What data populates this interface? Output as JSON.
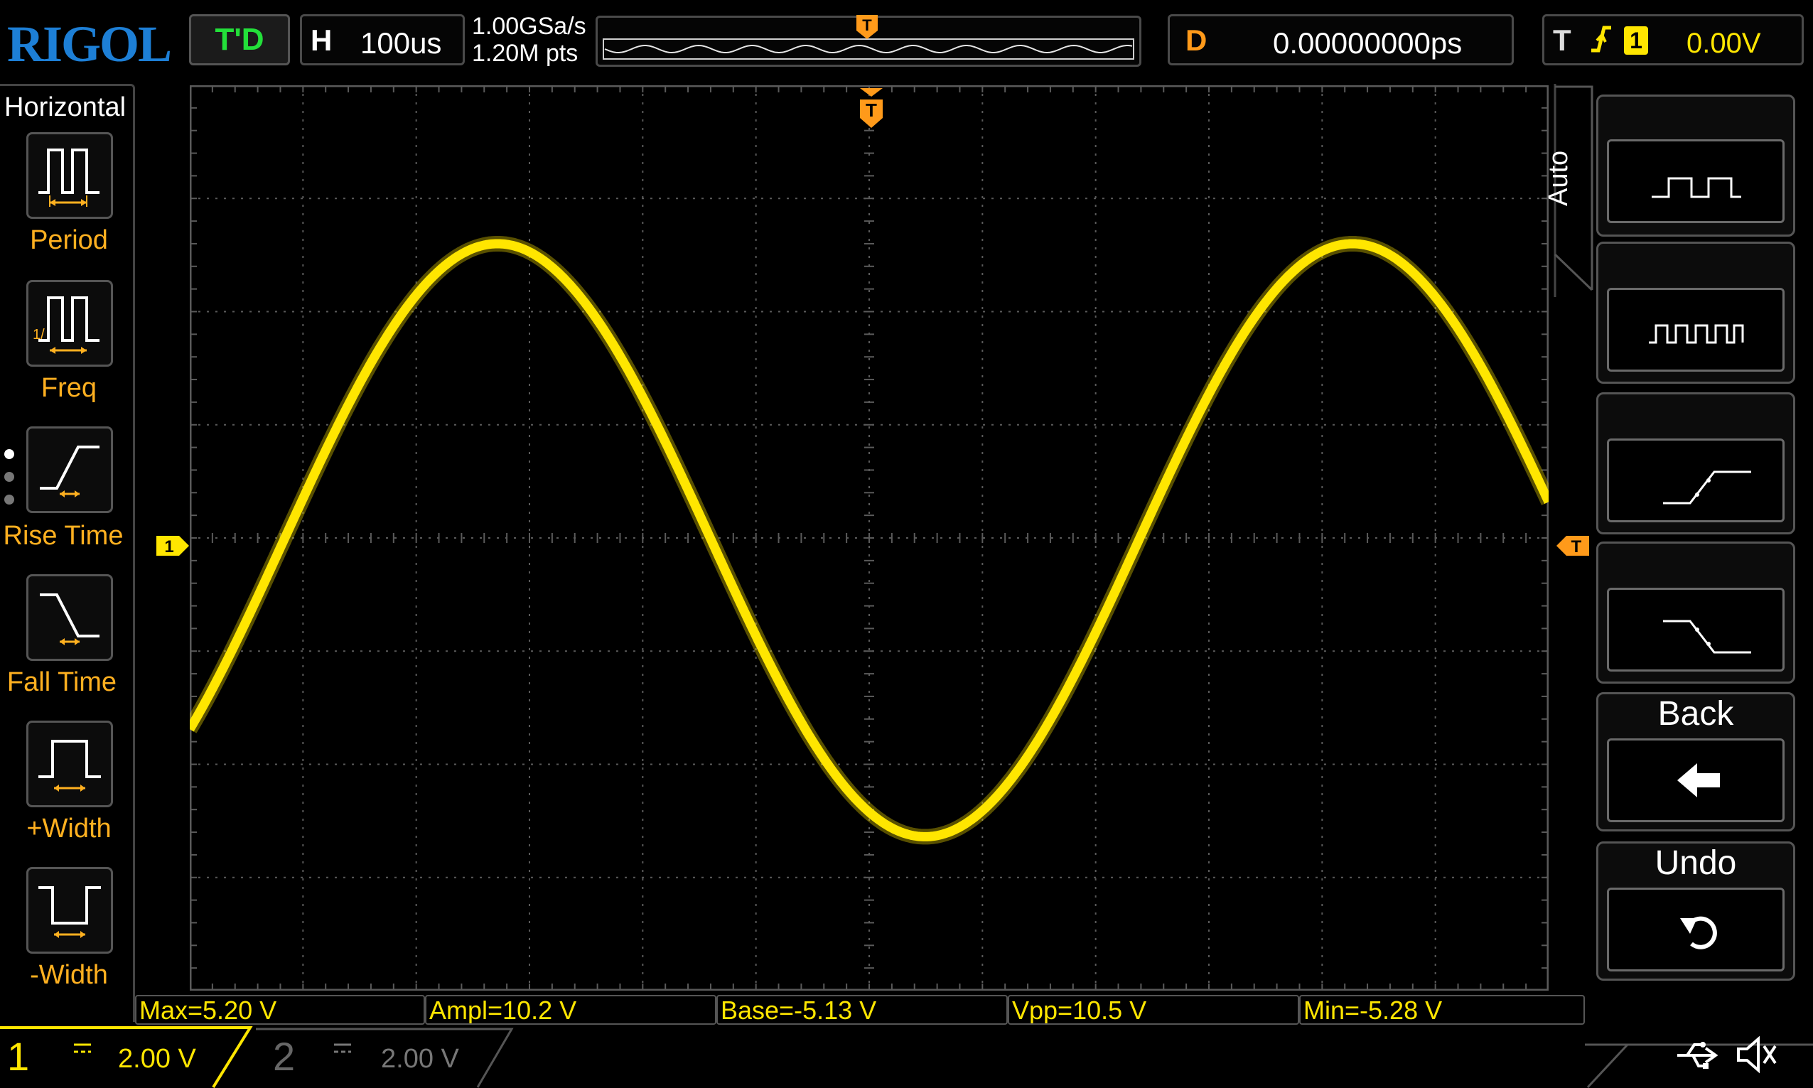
{
  "header": {
    "brand": "RIGOL",
    "run_status": "T'D",
    "horizontal_label": "H",
    "timebase": "100us",
    "sample_rate": "1.00GSa/s",
    "memory_depth": "1.20M pts",
    "delay_label": "D",
    "delay_value": "0.00000000ps",
    "trigger_label": "T",
    "trigger_slope_icon": "rising-edge-icon",
    "trigger_source": "1",
    "trigger_level": "0.00V"
  },
  "left_menu": {
    "title": "Horizontal",
    "items": [
      {
        "label": "Period",
        "icon": "period-icon"
      },
      {
        "label": "Freq",
        "icon": "frequency-icon"
      },
      {
        "label": "Rise Time",
        "icon": "rise-time-icon"
      },
      {
        "label": "Fall Time",
        "icon": "fall-time-icon"
      },
      {
        "label": "+Width",
        "icon": "positive-width-icon"
      },
      {
        "label": "-Width",
        "icon": "negative-width-icon"
      }
    ]
  },
  "right_menu": {
    "tab_label": "Auto",
    "back_label": "Back",
    "undo_label": "Undo"
  },
  "markers": {
    "trigger_position": "T",
    "trigger_level": "T",
    "channel1_offset": "1"
  },
  "measurements": [
    {
      "label": "Max=5.20 V"
    },
    {
      "label": "Ampl=10.2 V"
    },
    {
      "label": "Base=-5.13 V"
    },
    {
      "label": "Vpp=10.5 V"
    },
    {
      "label": "Min=-5.28 V"
    }
  ],
  "channels": [
    {
      "number": "1",
      "scale": "2.00 V",
      "active": true
    },
    {
      "number": "2",
      "scale": "2.00 V",
      "active": false
    }
  ],
  "waveform": {
    "channel": "1",
    "color": "#ffe600",
    "shape": "sine",
    "peak_volts": 5.2,
    "trough_volts": -5.28,
    "volts_per_div": 2.0,
    "time_per_div_us": 100,
    "period_divisions": 7.55,
    "phase_at_left_divisions": 0
  },
  "colors": {
    "channel1": "#ffe600",
    "trigger": "#ff9a1a",
    "run_status": "#23e03a",
    "brand": "#1d7fd6",
    "grid": "#5a5a5a"
  }
}
